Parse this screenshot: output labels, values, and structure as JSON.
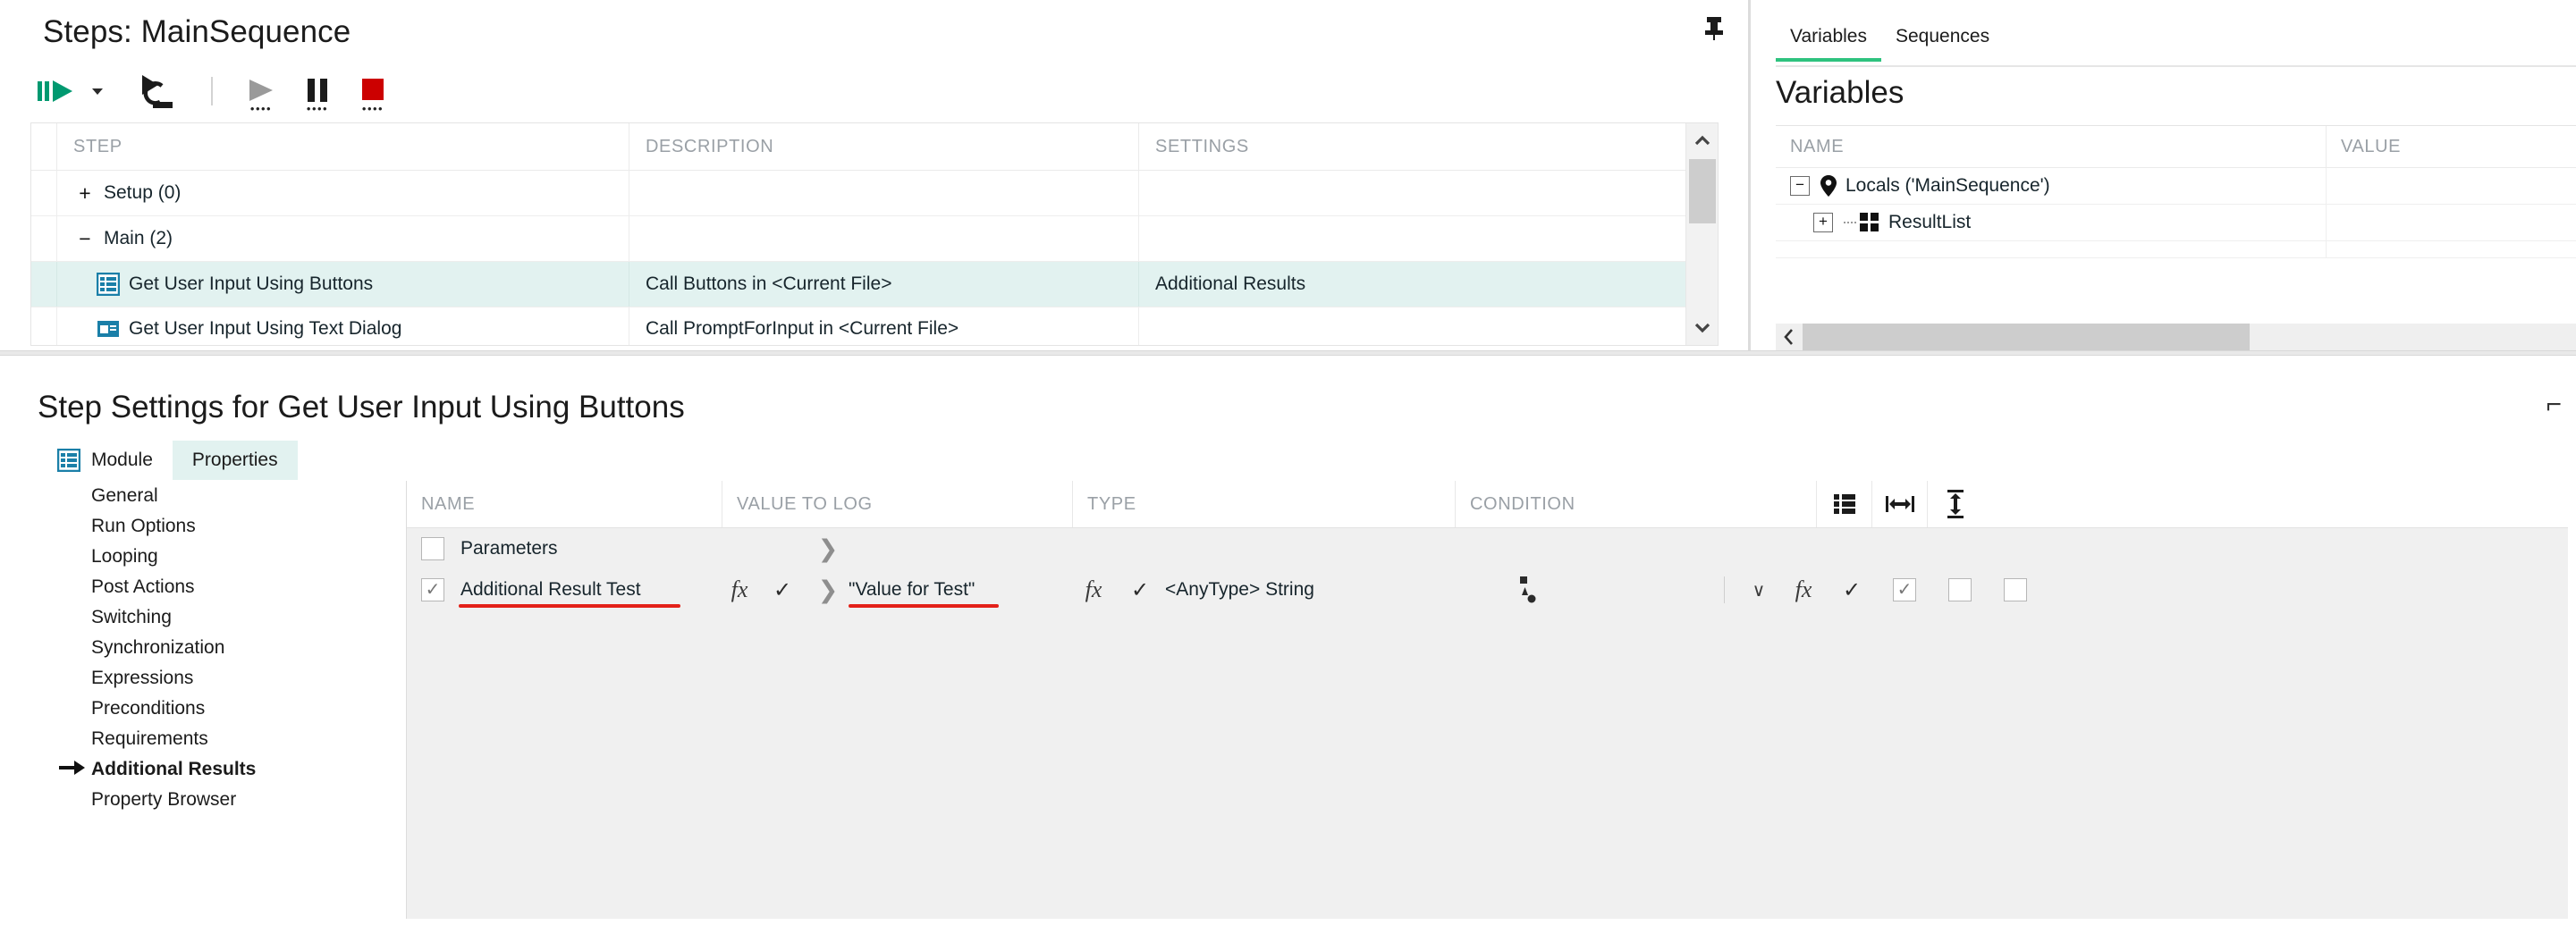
{
  "steps_panel": {
    "title": "Steps: MainSequence",
    "pin_icon": "pin-icon",
    "toolbar": [
      {
        "name": "run-sequence-button",
        "icon": "run-green-icon",
        "label": "Run"
      },
      {
        "name": "run-dropdown-button",
        "icon": "chevron-down-icon",
        "label": ""
      },
      {
        "name": "step-into-button",
        "icon": "step-into-icon",
        "label": "Step Into"
      },
      {
        "name": "resume-button",
        "icon": "play-gray-icon",
        "label": "Resume"
      },
      {
        "name": "break-button",
        "icon": "pause-icon",
        "label": "Break"
      },
      {
        "name": "terminate-button",
        "icon": "stop-red-icon",
        "label": "Terminate"
      }
    ],
    "columns": [
      "STEP",
      "DESCRIPTION",
      "SETTINGS"
    ],
    "rows": [
      {
        "toggle": "+",
        "step": "Setup (0)",
        "description": "",
        "settings": "",
        "kind": "group",
        "selected": false
      },
      {
        "toggle": "−",
        "step": "Main (2)",
        "description": "",
        "settings": "",
        "kind": "group",
        "selected": false
      },
      {
        "toggle": "",
        "step": "Get User Input Using Buttons",
        "description": "Call Buttons in <Current File>",
        "settings": "Additional Results",
        "kind": "step",
        "selected": true
      },
      {
        "toggle": "",
        "step": "Get User Input Using Text Dialog",
        "description": "Call PromptForInput in <Current File>",
        "settings": "",
        "kind": "step",
        "selected": false
      }
    ]
  },
  "variables_panel": {
    "tabs": [
      {
        "label": "Variables",
        "active": true
      },
      {
        "label": "Sequences",
        "active": false
      }
    ],
    "title": "Variables",
    "columns": [
      "NAME",
      "VALUE"
    ],
    "rows": [
      {
        "expander": "−",
        "icon": "location-pin-icon",
        "name": "Locals ('MainSequence')",
        "value": "",
        "indent": 0
      },
      {
        "expander": "+",
        "icon": "grid-squares-icon",
        "name": "ResultList",
        "value": "",
        "indent": 1
      }
    ],
    "hscroll_left_icon": "chevron-left-icon"
  },
  "step_settings": {
    "title": "Step Settings for Get User Input Using Buttons",
    "collapse_icon": "collapse-icon",
    "tabs": [
      {
        "label": "Module",
        "icon": "module-icon",
        "active": false
      },
      {
        "label": "Properties",
        "icon": "",
        "active": true
      }
    ],
    "categories": [
      {
        "label": "General",
        "active": false
      },
      {
        "label": "Run Options",
        "active": false
      },
      {
        "label": "Looping",
        "active": false
      },
      {
        "label": "Post Actions",
        "active": false
      },
      {
        "label": "Switching",
        "active": false
      },
      {
        "label": "Synchronization",
        "active": false
      },
      {
        "label": "Expressions",
        "active": false
      },
      {
        "label": "Preconditions",
        "active": false
      },
      {
        "label": "Requirements",
        "active": false
      },
      {
        "label": "Additional Results",
        "active": true
      },
      {
        "label": "Property Browser",
        "active": false
      }
    ],
    "grid": {
      "columns": [
        "NAME",
        "VALUE TO LOG",
        "TYPE",
        "CONDITION"
      ],
      "header_icons": [
        "list-view-icon",
        "fit-width-icon",
        "fit-height-icon"
      ],
      "rows": [
        {
          "checked": false,
          "name": "Parameters",
          "name_underlined": false,
          "has_fx": false,
          "expand_icon": "chevron-right-icon",
          "value_to_log": "",
          "value_underlined": false,
          "type_has_fx": false,
          "type": "",
          "condition_icon": "",
          "has_condition_controls": false
        },
        {
          "checked": true,
          "name": "Additional Result Test",
          "name_underlined": true,
          "has_fx": true,
          "expand_icon": "chevron-right-icon",
          "value_to_log": "\"Value for Test\"",
          "value_underlined": true,
          "type_has_fx": true,
          "type": "<AnyType> String",
          "condition_icon": "shape-picker-icon",
          "has_condition_controls": true
        }
      ]
    }
  },
  "colors": {
    "selection": "#e2f2f0",
    "accent_green": "#2ec27e",
    "stop_red": "#cc0000",
    "annotation_red": "#e32119",
    "icon_blue": "#1a7fa8",
    "header_text": "#9aa0a6"
  }
}
